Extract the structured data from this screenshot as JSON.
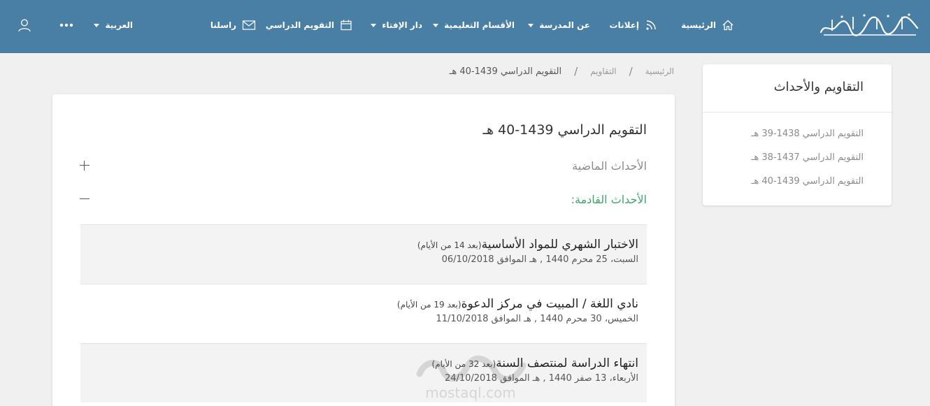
{
  "header": {
    "logo_text": "مدرسة ابن عباس",
    "nav": {
      "home": "الرئيسية",
      "ads": "إعلانات",
      "about": "عن المدرسة",
      "departments": "الأقسام التعليمية",
      "fatwa": "دار الإفتاء",
      "calendar": "التقويم الدراسي",
      "contact": "راسلنا",
      "language": "العربية"
    },
    "icons": [
      "home-icon",
      "rss-icon",
      "calendar-icon",
      "envelope-icon",
      "more-icon",
      "user-icon"
    ]
  },
  "breadcrumb": {
    "home": "الرئيسية",
    "sep": "/",
    "calendars": "التقاويم",
    "current": "التقويم الدراسي 1439-40 هـ"
  },
  "sidebar": {
    "title": "التقاويم والأحداث",
    "items": [
      "التقويم الدراسي 1438-39 هـ",
      "التقويم الدراسي 1437-38 هـ",
      "التقويم الدراسي 1439-40 هـ"
    ]
  },
  "main": {
    "title": "التقويم الدراسي 1439-40 هـ",
    "past_label": "الأحداث الماضية",
    "upcoming_label": "الأحداث القادمة:",
    "events": [
      {
        "title": "الاختبار الشهري للمواد الأساسية",
        "relative": "(بعد 14 من الأيام)",
        "date": "السبت، 25 محرم 1440 , هـ الموافق 06/10/2018"
      },
      {
        "title": "نادي اللغة / المبيت في مركز الدعوة",
        "relative": "(بعد 19 من الأيام)",
        "date": "الخميس، 30 محرم 1440 , هـ الموافق 11/10/2018"
      },
      {
        "title": "انتهاء الدراسة لمنتصف السنة",
        "relative": "(بعد 32 من الأيام)",
        "date": "الأربعاء، 13 صفر 1440 , هـ الموافق 24/10/2018"
      }
    ]
  },
  "watermark": {
    "text": "مستقل",
    "subtext": "mostaql.com"
  },
  "colors": {
    "header_bg": "#4a7fa5",
    "accent_green": "#3aa86b",
    "page_bg": "#f0f0f0"
  }
}
